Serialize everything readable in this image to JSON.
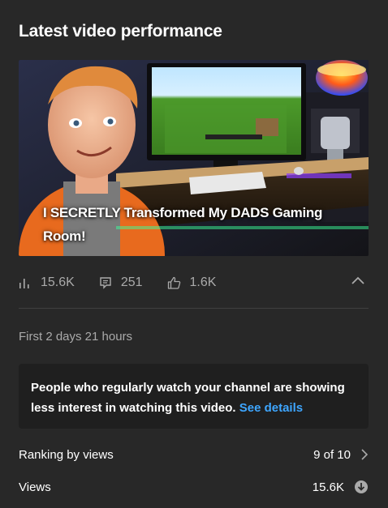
{
  "header": {
    "title": "Latest video performance"
  },
  "video": {
    "title": "I SECRETLY Transformed My DADS Gaming Room!"
  },
  "stats": {
    "views": "15.6K",
    "comments": "251",
    "likes": "1.6K"
  },
  "period": "First 2 days 21 hours",
  "notice": {
    "text": "People who regularly watch your channel are showing less interest in watching this video.",
    "link": "See details"
  },
  "ranking": {
    "label": "Ranking by views",
    "value": "9 of 10"
  },
  "views_row": {
    "label": "Views",
    "value": "15.6K"
  },
  "colors": {
    "background": "#282828",
    "panel": "#1f1f1f",
    "link": "#3ea6ff",
    "muted": "#aaaaaa"
  }
}
